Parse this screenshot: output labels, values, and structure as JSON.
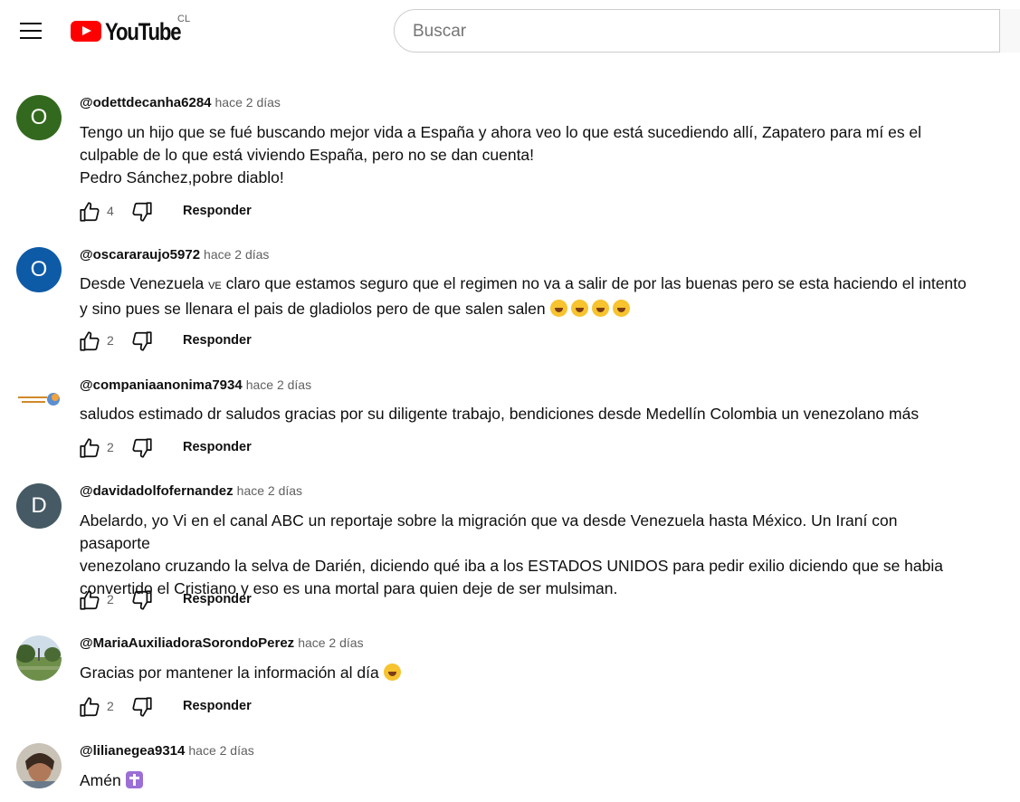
{
  "header": {
    "logo_text": "YouTube",
    "region": "CL",
    "search_placeholder": "Buscar"
  },
  "reply_label": "Responder",
  "comments": [
    {
      "author": "@odettdecanha6284",
      "time": "hace 2 días",
      "avatar_letter": "O",
      "avatar_color": "#33691e",
      "text": "Tengo un hijo que se fué buscando mejor vida a España y ahora veo lo que está sucediendo allí, Zapatero para mí es el\nculpable de lo que está viviendo España, pero no se dan cuenta!\nPedro Sánchez,pobre diablo!",
      "likes": "4"
    },
    {
      "author": "@oscararaujo5972",
      "time": "hace 2 días",
      "avatar_letter": "O",
      "avatar_color": "#0d5aa7",
      "text_start": "Desde Venezuela ",
      "text_small": "VE",
      "text_rest": " claro que estamos seguro que el regimen no va a salir de por las buenas pero se esta haciendo el intento\ny sino pues se llenara el pais de gladiolos pero de que salen salen ",
      "emoji": [
        "tears-of-joy",
        "tears-of-joy",
        "tears-of-joy",
        "tears-of-joy"
      ],
      "likes": "2"
    },
    {
      "author": "@companiaanonima7934",
      "time": "hace 2 días",
      "text": "saludos estimado dr saludos gracias por su diligente trabajo, bendiciones desde Medellín Colombia un venezolano más",
      "likes": "2"
    },
    {
      "author": "@davidadolfofernandez",
      "time": "hace 2 días",
      "avatar_letter": "D",
      "avatar_color": "#455a64",
      "text": "Abelardo, yo Vi en el canal ABC un reportaje sobre la migración que va desde Venezuela hasta México. Un Iraní con pasaporte\nvenezolano cruzando la selva de Darién, diciendo qué iba a los ESTADOS UNIDOS para pedir exilio diciendo que se habia\nconvertido el Cristiano y eso es una mortal para quien deje de ser mulsiman.",
      "likes": "2"
    },
    {
      "author": "@MariaAuxiliadoraSorondoPerez",
      "time": "hace 2 días",
      "text": "Gracias por mantener la información  al día ",
      "emoji": "winking-face",
      "likes": "2"
    },
    {
      "author": "@lilianegea9314",
      "time": "hace 2 días",
      "text": "Amén ",
      "emoji": "latin-cross"
    }
  ]
}
